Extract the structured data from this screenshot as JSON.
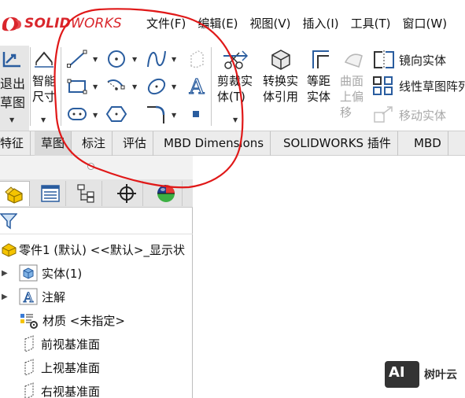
{
  "app": {
    "logo_mark": "DS",
    "logo_bold": "SOLID",
    "logo_thin": "WORKS"
  },
  "menu": [
    "文件(F)",
    "编辑(E)",
    "视图(V)",
    "插入(I)",
    "工具(T)",
    "窗口(W)"
  ],
  "ribbon": {
    "exit_sketch": [
      "退出",
      "草图"
    ],
    "smart_dim": [
      "智能",
      "尺寸"
    ],
    "trim": [
      "剪裁实",
      "体(T)"
    ],
    "convert": [
      "转换实",
      "体引用"
    ],
    "offset": [
      "等距",
      "实体"
    ],
    "surface_offset": [
      "曲面",
      "上偏",
      "移"
    ],
    "mirror": "镜向实体",
    "linear_pattern": "线性草图阵列",
    "move": "移动实体"
  },
  "tabs": [
    "特征",
    "草图",
    "标注",
    "评估",
    "MBD Dimensions",
    "SOLIDWORKS 插件",
    "MBD"
  ],
  "active_tab": "草图",
  "tree": {
    "root": "零件1 (默认) <<默认>_显示状",
    "items": [
      "实体(1)",
      "注解",
      "材质 <未指定>",
      "前视基准面",
      "上视基准面",
      "右视基准面"
    ]
  },
  "watermark": {
    "badge": "AI",
    "name": "树叶云"
  },
  "colors": {
    "accent_red": "#d9262c",
    "annotation": "#e01818",
    "icon_blue": "#2a5d9f"
  }
}
